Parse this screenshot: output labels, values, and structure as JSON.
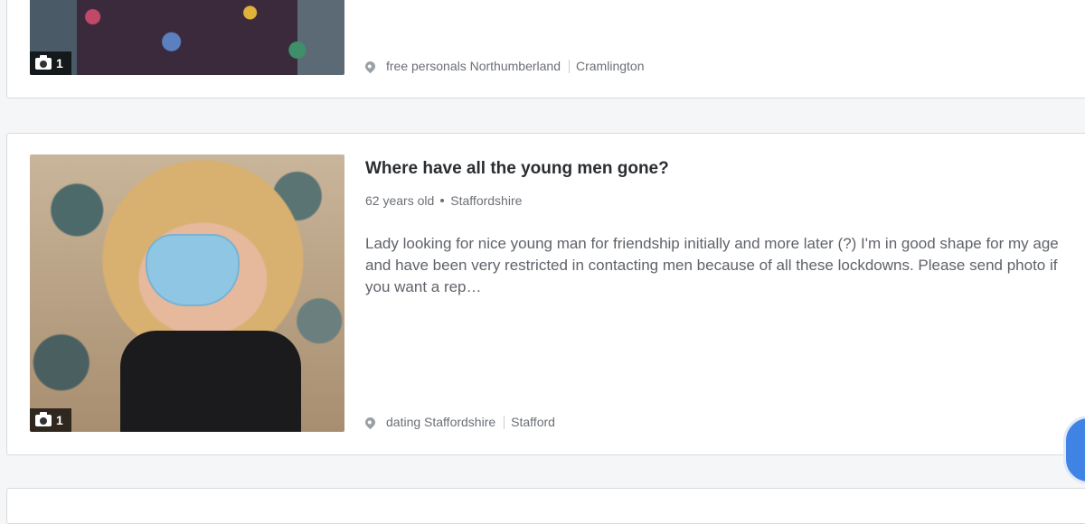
{
  "listings": [
    {
      "photo_count": "1",
      "location_link": "free personals Northumberland",
      "town": "Cramlington"
    },
    {
      "title": "Where have all the young men gone?",
      "age": "62 years old",
      "region": "Staffordshire",
      "description": "Lady looking for nice young man for friendship initially and more later (?) I'm in good shape for my age and have been very restricted in contacting men because of all these lockdowns. Please send photo if you want a rep…",
      "photo_count": "1",
      "location_link": "dating Staffordshire",
      "town": "Stafford"
    }
  ],
  "icons": {
    "camera": "camera-icon",
    "location": "map-pin-icon"
  },
  "colors": {
    "accent": "#3f84e5",
    "card_border": "#d8dadd",
    "page_bg": "#f5f6f8"
  }
}
